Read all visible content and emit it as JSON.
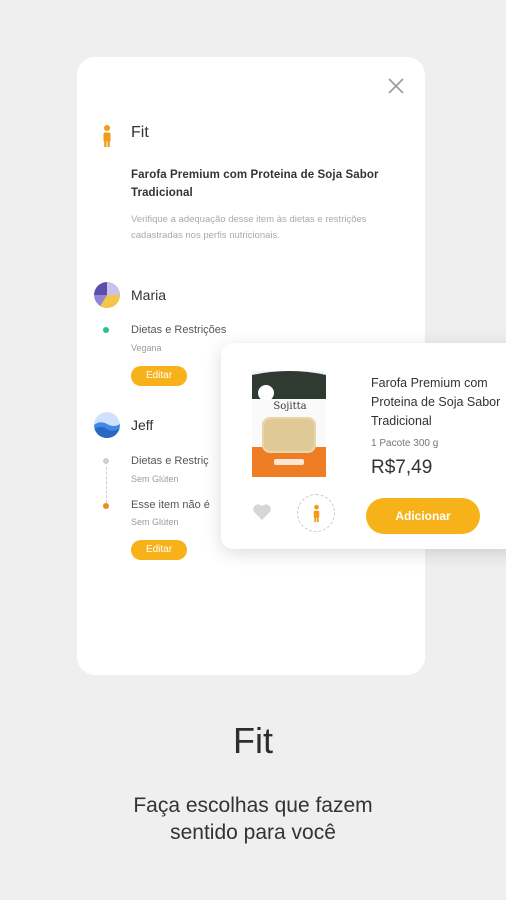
{
  "fit_panel": {
    "title": "Fit",
    "product_name": "Farofa Premium com Proteina de Soja Sabor Tradicional",
    "description": "Verifique a adequação desse item às dietas e restrições cadastradas nos perfis nutricionais."
  },
  "profiles": [
    {
      "name": "Maria",
      "entries": [
        {
          "label": "Dietas e Restrições",
          "value": "Vegana"
        }
      ],
      "edit_label": "Editar"
    },
    {
      "name": "Jeff",
      "entries": [
        {
          "label": "Dietas e Restriç",
          "value": "Sem Glúten"
        },
        {
          "label": "Esse item não é",
          "value": "Sem Glúten"
        }
      ],
      "edit_label": "Editar"
    }
  ],
  "product_card": {
    "title": "Farofa Premium com Proteina de Soja Sabor Tradicional",
    "quantity": "1 Pacote 300 g",
    "price": "R$7,49",
    "add_label": "Adicionar",
    "package_brand": "Sojitta"
  },
  "promo": {
    "title": "Fit",
    "subtitle_line1": "Faça escolhas que fazem",
    "subtitle_line2": "sentido para você"
  },
  "colors": {
    "accent": "#f7b21a",
    "fit_icon": "#f39a1a",
    "ok_dot": "#2bbf8a",
    "warn_dot": "#f08a1c"
  }
}
